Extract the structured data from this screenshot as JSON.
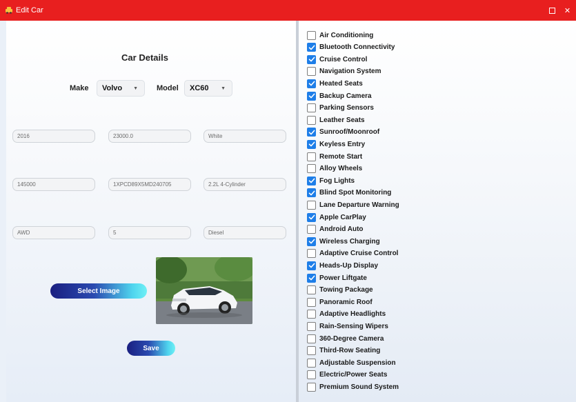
{
  "window": {
    "title": "Edit Car"
  },
  "car_details": {
    "heading": "Car Details",
    "make_label": "Make",
    "make_value": "Volvo",
    "model_label": "Model",
    "model_value": "XC60",
    "fields": [
      {
        "name": "year-field",
        "value": "2016"
      },
      {
        "name": "price-field",
        "value": "23000.0"
      },
      {
        "name": "color-field",
        "value": "White"
      },
      {
        "name": "mileage-field",
        "value": "145000"
      },
      {
        "name": "vin-field",
        "value": "1XPCD89X5MD240705"
      },
      {
        "name": "engine-field",
        "value": "2.2L 4-Cylinder"
      },
      {
        "name": "drivetrain-field",
        "value": "AWD"
      },
      {
        "name": "seats-field",
        "value": "5"
      },
      {
        "name": "fuel-type-field",
        "value": "Diesel"
      }
    ],
    "select_image_label": "Select Image",
    "save_label": "Save"
  },
  "features": [
    {
      "label": "Air Conditioning",
      "checked": false
    },
    {
      "label": "Bluetooth Connectivity",
      "checked": true
    },
    {
      "label": "Cruise Control",
      "checked": true
    },
    {
      "label": "Navigation System",
      "checked": false
    },
    {
      "label": "Heated Seats",
      "checked": true
    },
    {
      "label": "Backup Camera",
      "checked": true
    },
    {
      "label": "Parking Sensors",
      "checked": false
    },
    {
      "label": "Leather Seats",
      "checked": false
    },
    {
      "label": "Sunroof/Moonroof",
      "checked": true
    },
    {
      "label": "Keyless Entry",
      "checked": true
    },
    {
      "label": "Remote Start",
      "checked": false
    },
    {
      "label": "Alloy Wheels",
      "checked": false
    },
    {
      "label": "Fog Lights",
      "checked": true
    },
    {
      "label": "Blind Spot Monitoring",
      "checked": true
    },
    {
      "label": "Lane Departure Warning",
      "checked": false
    },
    {
      "label": "Apple CarPlay",
      "checked": true
    },
    {
      "label": "Android Auto",
      "checked": false
    },
    {
      "label": "Wireless Charging",
      "checked": true
    },
    {
      "label": "Adaptive Cruise Control",
      "checked": false
    },
    {
      "label": "Heads-Up Display",
      "checked": true
    },
    {
      "label": "Power Liftgate",
      "checked": true
    },
    {
      "label": "Towing Package",
      "checked": false
    },
    {
      "label": "Panoramic Roof",
      "checked": false
    },
    {
      "label": "Adaptive Headlights",
      "checked": false
    },
    {
      "label": "Rain-Sensing Wipers",
      "checked": false
    },
    {
      "label": "360-Degree Camera",
      "checked": false
    },
    {
      "label": "Third-Row Seating",
      "checked": false
    },
    {
      "label": "Adjustable Suspension",
      "checked": false
    },
    {
      "label": "Electric/Power Seats",
      "checked": false
    },
    {
      "label": "Premium Sound System",
      "checked": false
    }
  ],
  "colors": {
    "titlebar": "#e81f1f",
    "checkbox_checked": "#1e7ee8",
    "button_gradient_start": "#1a1f80",
    "button_gradient_end": "#6ff0f5"
  }
}
